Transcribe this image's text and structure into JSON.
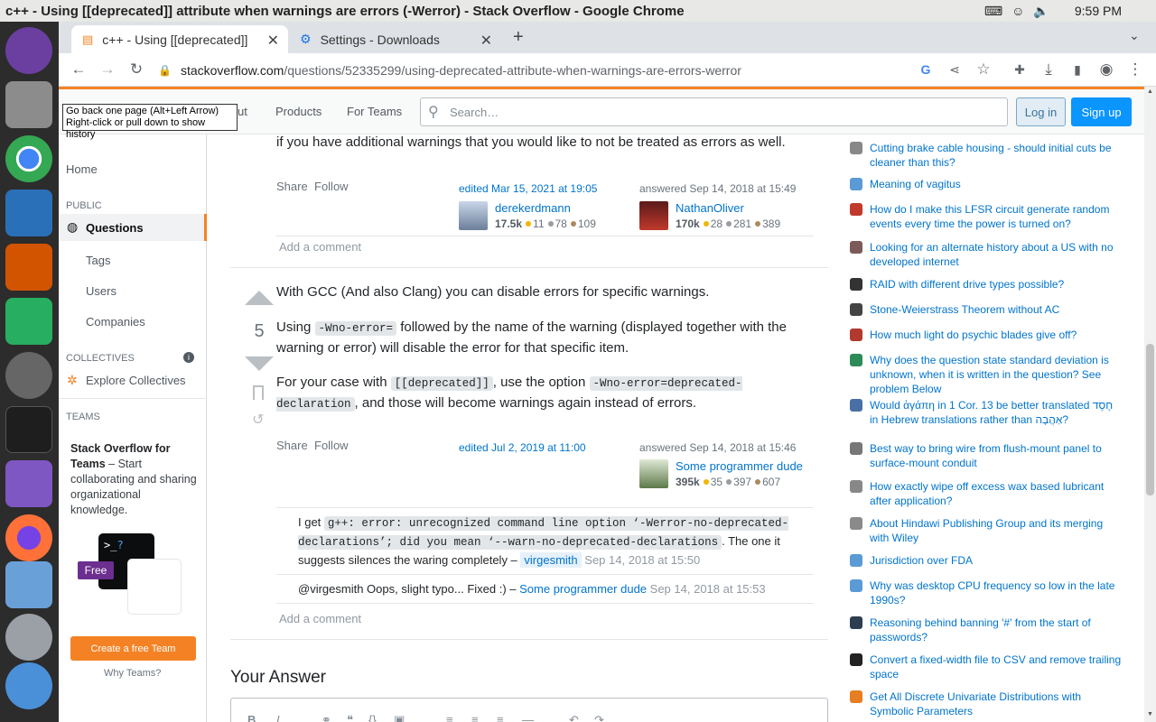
{
  "os": {
    "window_title": "c++ - Using [[deprecated]] attribute when warnings are errors (-Werror) - Stack Overflow - Google Chrome",
    "clock": "9:59 PM"
  },
  "browser": {
    "tabs": [
      {
        "label": "c++ - Using [[deprecated]]",
        "icon": "stackoverflow-icon"
      },
      {
        "label": "Settings - Downloads",
        "icon": "settings-gear-icon"
      }
    ],
    "url_host": "stackoverflow.com",
    "url_path": "/questions/52335299/using-deprecated-attribute-when-warnings-are-errors-werror",
    "back_tooltip_line1": "Go back one page (Alt+Left Arrow)",
    "back_tooltip_line2": "Right-click or pull down to show history"
  },
  "header": {
    "about": "ut",
    "products": "Products",
    "for_teams": "For Teams",
    "search_placeholder": "Search…",
    "login": "Log in",
    "signup": "Sign up"
  },
  "leftnav": {
    "home": "Home",
    "public": "PUBLIC",
    "questions": "Questions",
    "tags": "Tags",
    "users": "Users",
    "companies": "Companies",
    "collectives": "COLLECTIVES",
    "explore_collectives": "Explore Collectives",
    "teams": "TEAMS",
    "teams_title": "Stack Overflow for Teams",
    "teams_text": " – Start collaborating and sharing organizational knowledge.",
    "free_badge": "Free",
    "create_team": "Create a free Team",
    "why_teams": "Why Teams?"
  },
  "answer1": {
    "text_tail": "if you have additional warnings that you would like to not be treated as errors as well.",
    "share": "Share",
    "follow": "Follow",
    "edited": "edited Mar 15, 2021 at 19:05",
    "editor_name": "derekerdmann",
    "editor_rep": "17.5k",
    "editor_gold": "11",
    "editor_silver": "78",
    "editor_bronze": "109",
    "answered": "answered Sep 14, 2018 at 15:49",
    "author_name": "NathanOliver",
    "author_rep": "170k",
    "author_gold": "28",
    "author_silver": "281",
    "author_bronze": "389",
    "add_comment": "Add a comment"
  },
  "answer2": {
    "votes": "5",
    "p1": "With GCC (And also Clang) you can disable errors for specific warnings.",
    "p2_a": "Using ",
    "p2_code": "-Wno-error=",
    "p2_b": " followed by the name of the warning (displayed together with the warning or error) will disable the error for that specific item.",
    "p3_a": "For your case with ",
    "p3_code1": "[[deprecated]]",
    "p3_b": ", use the option ",
    "p3_code2": "-Wno-error=deprecated-declaration",
    "p3_c": ", and those will become warnings again instead of errors.",
    "share": "Share",
    "follow": "Follow",
    "edited": "edited Jul 2, 2019 at 11:00",
    "answered": "answered Sep 14, 2018 at 15:46",
    "author_name": "Some programmer dude",
    "author_rep": "395k",
    "author_gold": "35",
    "author_silver": "397",
    "author_bronze": "607",
    "comments": [
      {
        "pre": "I get ",
        "code": "g++: error: unrecognized command line option ‘-Werror-no-deprecated-declarations’; did you mean ‘--warn-no-deprecated-declarations",
        "post": ". The one it suggests silences the waring completely – ",
        "user": "virgesmith",
        "date": "Sep 14, 2018 at 15:50"
      },
      {
        "pre": "@virgesmith Oops, slight typo... Fixed :) – ",
        "user": "Some programmer dude",
        "date": "Sep 14, 2018 at 15:53"
      }
    ],
    "add_comment": "Add a comment"
  },
  "your_answer": "Your Answer",
  "hot_questions": [
    {
      "title": "Cutting brake cable housing - should initial cuts be cleaner than this?",
      "icon": "bicycles-icon",
      "color": "#888888"
    },
    {
      "title": "Meaning of vagitus",
      "icon": "latin-icon",
      "color": "#5b9bd5"
    },
    {
      "title": "How do I make this LFSR circuit generate random events every time the power is turned on?",
      "icon": "electronics-icon",
      "color": "#c0392b"
    },
    {
      "title": "Looking for an alternate history about a US with no developed internet",
      "icon": "scifi-icon",
      "color": "#7d5a5a"
    },
    {
      "title": "RAID with different drive types possible?",
      "icon": "serverfault-icon",
      "color": "#333333"
    },
    {
      "title": "Stone-Weierstrass Theorem without AC",
      "icon": "mathoverflow-icon",
      "color": "#444444"
    },
    {
      "title": "How much light do psychic blades give off?",
      "icon": "rpg-icon",
      "color": "#b03a2e"
    },
    {
      "title": "Why does the question state standard deviation is unknown, when it is written in the question? See problem Below",
      "icon": "stats-icon",
      "color": "#2e8b57"
    },
    {
      "title": "Would ἀγάπη in 1 Cor. 13 be better translated חֶסֶד in Hebrew translations rather than אַהֲבָה?",
      "icon": "hermeneutics-icon",
      "color": "#4a6fa5"
    },
    {
      "title": "Best way to bring wire from flush-mount panel to surface-mount conduit",
      "icon": "diy-icon",
      "color": "#777777"
    },
    {
      "title": "How exactly wipe off excess wax based lubricant after application?",
      "icon": "bicycles-icon",
      "color": "#888888"
    },
    {
      "title": "About Hindawi Publishing Group and its merging with Wiley",
      "icon": "academia-icon",
      "color": "#8a8a8a"
    },
    {
      "title": "Jurisdiction over FDA",
      "icon": "law-icon",
      "color": "#5b9bd5"
    },
    {
      "title": "Why was desktop CPU frequency so low in the late 1990s?",
      "icon": "retrocomputing-icon",
      "color": "#5b9bd5"
    },
    {
      "title": "Reasoning behind banning '#' from the start of passwords?",
      "icon": "security-icon",
      "color": "#2c3e50"
    },
    {
      "title": "Convert a fixed-width file to CSV and remove trailing space",
      "icon": "unix-icon",
      "color": "#222222"
    },
    {
      "title": "Get All Discrete Univariate Distributions with Symbolic Parameters",
      "icon": "mathematica-icon",
      "color": "#e67e22"
    }
  ]
}
